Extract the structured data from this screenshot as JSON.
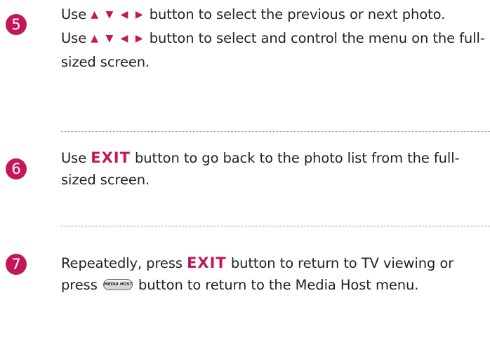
{
  "arrows": "▲ ▼ ◀ ▶",
  "steps": [
    {
      "number": "5",
      "para1": {
        "before": "Use ",
        "after": " button to select the previous or next photo."
      },
      "para2": {
        "before": "Use ",
        "after": " button to select and control the menu on the full-sized screen."
      }
    },
    {
      "number": "6",
      "before": "Use ",
      "keyword": "EXIT",
      "after": " button to go back to the photo list from the full-sized screen."
    },
    {
      "number": "7",
      "before": "Repeatedly, press ",
      "keyword": "EXIT",
      "middle": " button to return to TV viewing or press ",
      "icon_label": "MEDIA HOST",
      "after": " button to return to the Media Host menu."
    }
  ],
  "colors": {
    "accent": "#c2185b",
    "text": "#222222",
    "divider": "#8a8a8a"
  },
  "icons": {
    "navigation_arrows": "arrow-keys-icon",
    "media_host_button": "media-host-button-icon"
  }
}
